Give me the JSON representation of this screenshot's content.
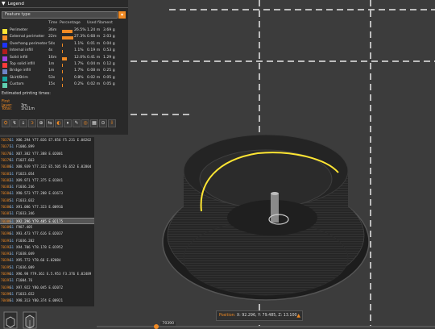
{
  "legend": {
    "title": "Legend",
    "feature_type_label": "Feature type",
    "columns": {
      "time": "Time",
      "percentage": "Percentage",
      "used_filament": "Used filament"
    },
    "features": [
      {
        "name": "Perimeter",
        "time": "36m",
        "percent": "26.5%",
        "length": "1.24 m",
        "weight": "3.69 g",
        "color": "#ffe633",
        "pct_value": 26.5
      },
      {
        "name": "External perimeter",
        "time": "22m",
        "percent": "27.3%",
        "length": "0.68 m",
        "weight": "2.03 g",
        "color": "#f58c29",
        "pct_value": 27.3
      },
      {
        "name": "Overhang perimeter",
        "time": "54s",
        "percent": "1.1%",
        "length": "0.01 m",
        "weight": "0.04 g",
        "color": "#1e33ff",
        "pct_value": 1.1
      },
      {
        "name": "Internal infill",
        "time": "4s",
        "percent": "1.1%",
        "length": "0.19 m",
        "weight": "0.53 g",
        "color": "#b01d1d",
        "pct_value": 1.1
      },
      {
        "name": "Solid infill",
        "time": "16m",
        "percent": "12.0%",
        "length": "0.41 m",
        "weight": "1.29 g",
        "color": "#a144e0",
        "pct_value": 12.0
      },
      {
        "name": "Top solid infill",
        "time": "1m",
        "percent": "1.7%",
        "length": "0.04 m",
        "weight": "0.12 g",
        "color": "#ff3a3a",
        "pct_value": 1.7
      },
      {
        "name": "Bridge infill",
        "time": "1m",
        "percent": "1.7%",
        "length": "0.08 m",
        "weight": "0.25 g",
        "color": "#6f84c8",
        "pct_value": 1.7
      },
      {
        "name": "Skirt/Brim",
        "time": "53s",
        "percent": "0.8%",
        "length": "0.02 m",
        "weight": "0.05 g",
        "color": "#16a6a0",
        "pct_value": 0.8
      },
      {
        "name": "Custom",
        "time": "15s",
        "percent": "0.2%",
        "length": "0.02 m",
        "weight": "0.05 g",
        "color": "#5fcfb0",
        "pct_value": 0.2
      }
    ],
    "estimated_title": "Estimated printing times:",
    "first_layer_label": "First layer:",
    "first_layer_value": "3m",
    "total_label": "Total:",
    "total_value": "1h21m"
  },
  "gcode": {
    "lines": [
      {
        "num": "70376",
        "cmd": "G1",
        "text": "X86.294 Y77.826 E7.856 F5.231 E.08202",
        "current": false
      },
      {
        "num": "70377",
        "cmd": "G1",
        "text": "F1006.899",
        "current": false
      },
      {
        "num": "70378",
        "cmd": "G1",
        "text": "X87.382 Y77.388 E.02001",
        "current": false
      },
      {
        "num": "70379",
        "cmd": "G1",
        "text": "F1027.663",
        "current": false
      },
      {
        "num": "70380",
        "cmd": "G1",
        "text": "X88.939 Y77.322 E5.505 F6.652 E.02804",
        "current": false
      },
      {
        "num": "70381",
        "cmd": "G1",
        "text": "F1023.054",
        "current": false
      },
      {
        "num": "70382",
        "cmd": "G1",
        "text": "X89.971 Y77.375 E.01841",
        "current": false
      },
      {
        "num": "70383",
        "cmd": "G1",
        "text": "F1036.246",
        "current": false
      },
      {
        "num": "70384",
        "cmd": "G1",
        "text": "X90.573 Y77.288 E.01673",
        "current": false
      },
      {
        "num": "70385",
        "cmd": "G1",
        "text": "F1033.032",
        "current": false
      },
      {
        "num": "70386",
        "cmd": "G1",
        "text": "X91.086 Y77.323 E.00916",
        "current": false
      },
      {
        "num": "70387",
        "cmd": "G1",
        "text": "F1033.346",
        "current": false
      },
      {
        "num": "70388",
        "cmd": "G1",
        "text": "X92.296 Y79.485 E.02175",
        "current": true
      },
      {
        "num": "70389",
        "cmd": "G1",
        "text": "F987.405",
        "current": false
      },
      {
        "num": "70390",
        "cmd": "G1",
        "text": "X93.473 Y77.616 E.02037",
        "current": false
      },
      {
        "num": "70391",
        "cmd": "G1",
        "text": "F1036.202",
        "current": false
      },
      {
        "num": "70392",
        "cmd": "G1",
        "text": "X94.706 Y78.178 E.01952",
        "current": false
      },
      {
        "num": "70393",
        "cmd": "G1",
        "text": "F1038.049",
        "current": false
      },
      {
        "num": "70394",
        "cmd": "G1",
        "text": "X95.772 Y78.66 E.02084",
        "current": false
      },
      {
        "num": "70395",
        "cmd": "G1",
        "text": "F1036.089",
        "current": false
      },
      {
        "num": "70396",
        "cmd": "G1",
        "text": "X96.98 Y79.361 E.5.953 F3.376 E.02489",
        "current": false
      },
      {
        "num": "70397",
        "cmd": "G1",
        "text": "F1004.76",
        "current": false
      },
      {
        "num": "70398",
        "cmd": "G1",
        "text": "X97.922 Y80.045 E.02072",
        "current": false
      },
      {
        "num": "70399",
        "cmd": "G1",
        "text": "F1033.652",
        "current": false
      },
      {
        "num": "70400",
        "cmd": "G1",
        "text": "X98.313 Y80.374 E.00921",
        "current": false
      }
    ]
  },
  "position": {
    "label": "Position:",
    "value": "X: 92.296, Y: 79.485, Z: 13.100"
  },
  "slider": {
    "label": "70390",
    "fraction": 0.17
  },
  "toolbar_icons": [
    "travel-icon",
    "wipe-icon",
    "retractions-icon",
    "deretractions-icon",
    "seams-icon",
    "tool-changes-icon",
    "color-changes-icon",
    "pause-prints-icon",
    "custom-gcode-icon",
    "center-of-gravity-icon",
    "shells-icon",
    "tool-marker-icon",
    "download-icon"
  ],
  "colors": {
    "accent": "#f08a24",
    "panel": "#282828",
    "background": "#3c3c3c",
    "toolpath_current": "#ffe633"
  }
}
